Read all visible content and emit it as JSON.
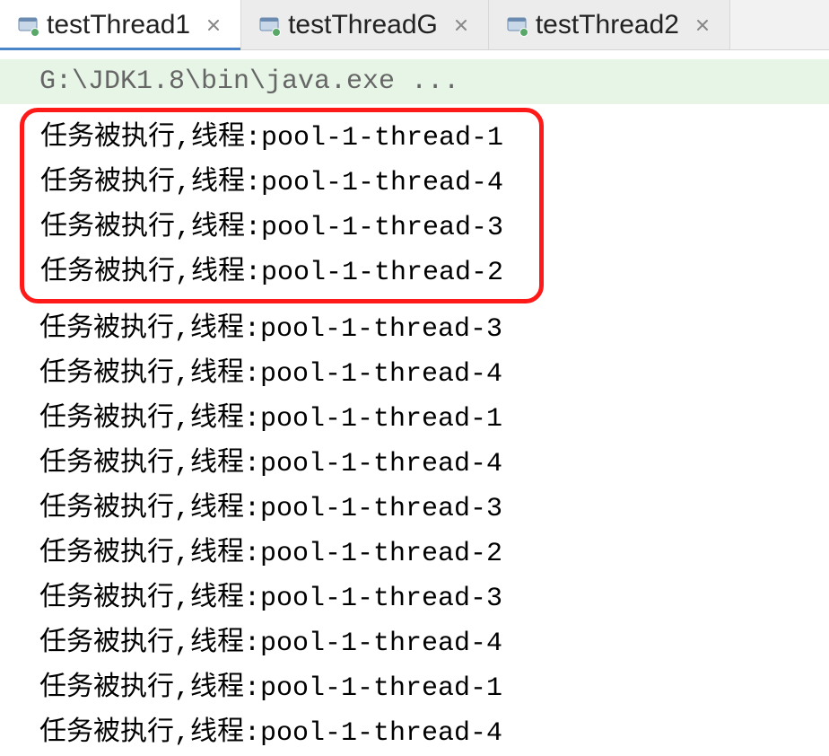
{
  "tabs": [
    {
      "label": "testThread1",
      "active": true,
      "status": "running"
    },
    {
      "label": "testThreadG",
      "active": false,
      "status": "running"
    },
    {
      "label": "testThread2",
      "active": false,
      "status": "running"
    }
  ],
  "console": {
    "header": "G:\\JDK1.8\\bin\\java.exe ...",
    "highlighted_lines": [
      "任务被执行,线程:pool-1-thread-1",
      "任务被执行,线程:pool-1-thread-4",
      "任务被执行,线程:pool-1-thread-3",
      "任务被执行,线程:pool-1-thread-2"
    ],
    "lines": [
      "任务被执行,线程:pool-1-thread-3",
      "任务被执行,线程:pool-1-thread-4",
      "任务被执行,线程:pool-1-thread-1",
      "任务被执行,线程:pool-1-thread-4",
      "任务被执行,线程:pool-1-thread-3",
      "任务被执行,线程:pool-1-thread-2",
      "任务被执行,线程:pool-1-thread-3",
      "任务被执行,线程:pool-1-thread-4",
      "任务被执行,线程:pool-1-thread-1",
      "任务被执行,线程:pool-1-thread-4"
    ]
  }
}
